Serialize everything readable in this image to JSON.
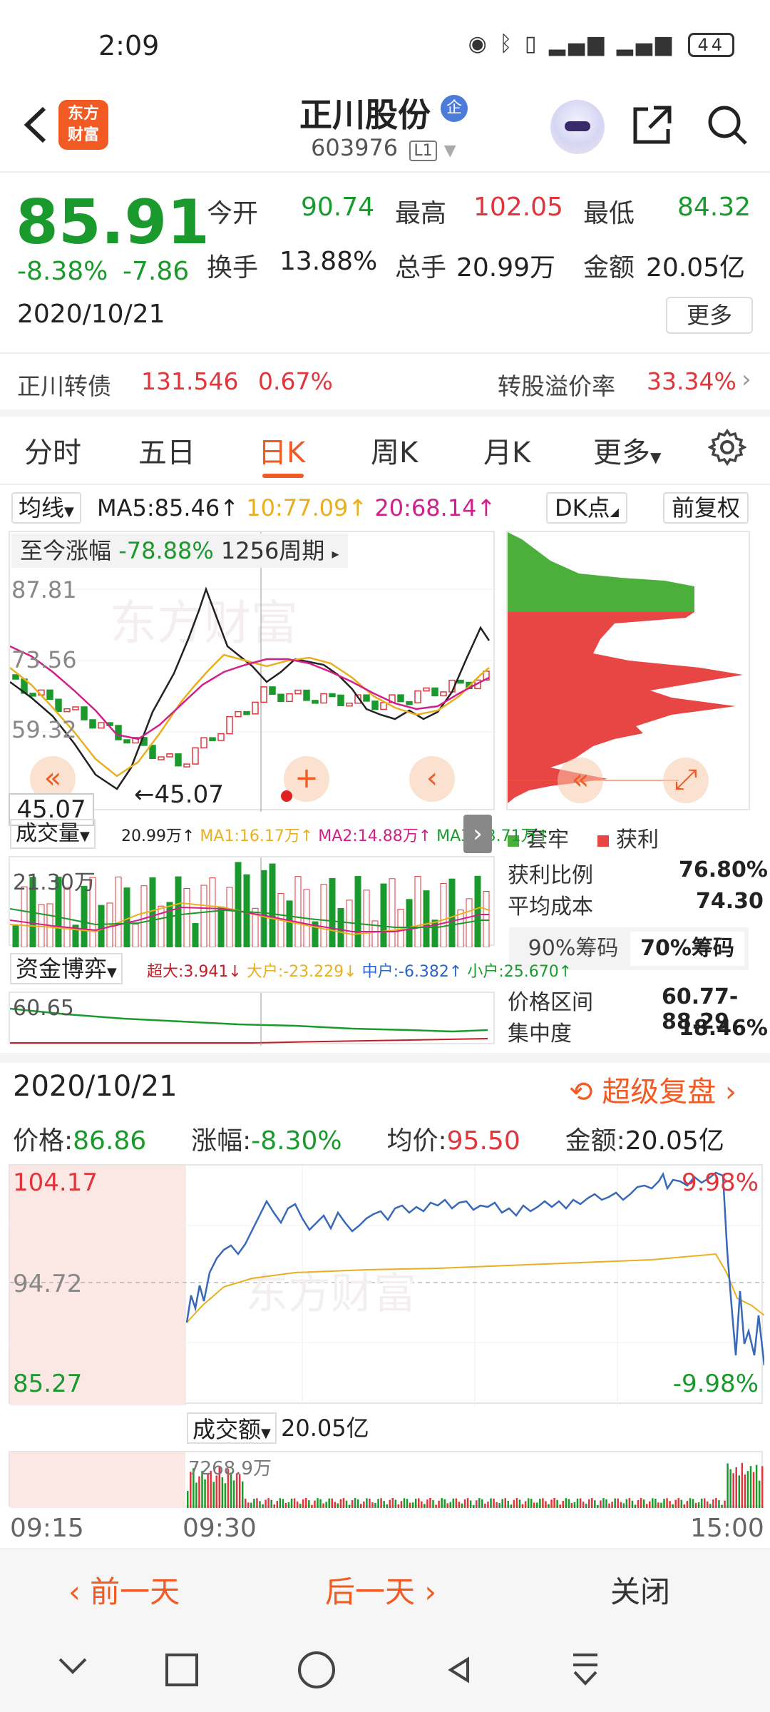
{
  "status": {
    "time": "2:09",
    "battery": "44"
  },
  "header": {
    "logo_line1": "东方",
    "logo_line2": "财富",
    "stock_name": "正川股份",
    "badge": "企",
    "stock_code": "603976",
    "level": "L1"
  },
  "quote": {
    "last_price": "85.91",
    "change_pct": "-8.38%",
    "change_amt": "-7.86",
    "date": "2020/10/21",
    "open_label": "今开",
    "open": "90.74",
    "high_label": "最高",
    "high": "102.05",
    "low_label": "最低",
    "low": "84.32",
    "turnover_label": "换手",
    "turnover": "13.88%",
    "volume_label": "总手",
    "volume": "20.99万",
    "amount_label": "金额",
    "amount": "20.05亿",
    "more_label": "更多"
  },
  "convertible": {
    "name": "正川转债",
    "price": "131.546",
    "pct": "0.67%",
    "premium_label": "转股溢价率",
    "premium_value": "33.34%"
  },
  "tabs": [
    "分时",
    "五日",
    "日K",
    "周K",
    "月K",
    "更多"
  ],
  "active_tab": "日K",
  "ma": {
    "select_label": "均线",
    "ma5": "MA5:85.46↑",
    "ma10": "10:77.09↑",
    "ma20": "20:68.14↑",
    "dk_label": "DK点",
    "fq_label": "前复权",
    "color_ma5": "#222222",
    "color_ma10": "#e8b020",
    "color_ma20": "#d0208a"
  },
  "kline": {
    "period_label": "至今涨幅",
    "period_pct": "-78.88%",
    "period_count": "1256周期",
    "y_labels": [
      "87.81",
      "73.56",
      "59.32"
    ],
    "low_marker": "45.07",
    "hover_price": "45.07",
    "watermark": "东方财富"
  },
  "chips": {
    "trapped_label": "套牢",
    "profit_label": "获利",
    "profit_ratio_label": "获利比例",
    "profit_ratio": "76.80%",
    "avg_cost_label": "平均成本",
    "avg_cost": "74.30",
    "tab_90": "90%筹码",
    "tab_70": "70%筹码",
    "range_label": "价格区间",
    "range": "60.77-88.29",
    "concentration_label": "集中度",
    "concentration": "18.46%",
    "color_trapped": "#4caf3c",
    "color_profit": "#e84545"
  },
  "volume": {
    "select_label": "成交量",
    "vol": "20.99万↑",
    "ma1": "MA1:16.17万↑",
    "ma2": "MA2:14.88万↑",
    "ma3": "MA3:13.71万↑",
    "y_label": "21.30万"
  },
  "fund_flow": {
    "select_label": "资金博弈",
    "super_large": "超大:3.941↓",
    "large": "大户:-23.229↓",
    "medium": "中户:-6.382↑",
    "small": "小户:25.670↑",
    "y_label": "60.65"
  },
  "intraday": {
    "date": "2020/10/21",
    "replay_label": "超级复盘",
    "price_label": "价格:",
    "price": "86.86",
    "pct_label": "涨幅:",
    "pct": "-8.30%",
    "avg_label": "均价:",
    "avg": "95.50",
    "amount_label": "金额:",
    "amount": "20.05亿",
    "y_high": "104.17",
    "y_mid": "94.72",
    "y_low": "85.27",
    "pct_high": "9.98%",
    "pct_low": "-9.98%",
    "amount_select": "成交额",
    "amount_total": "20.05亿",
    "amount_peak": "7268.9万",
    "times": [
      "09:15",
      "09:30",
      "15:00"
    ]
  },
  "bottom": {
    "prev_day": "前一天",
    "next_day": "后一天",
    "close": "关闭"
  }
}
